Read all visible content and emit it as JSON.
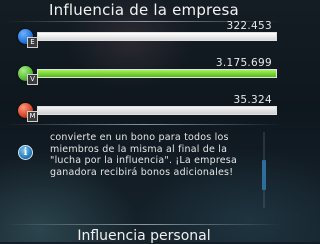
{
  "header": {
    "title": "Influencia de la empresa"
  },
  "companies": [
    {
      "letter": "E",
      "value_text": "322.453",
      "share": 1.0,
      "icon_color": "#1a6fd6",
      "bar_color": "#ffffff"
    },
    {
      "letter": "V",
      "value_text": "3.175.699",
      "share": 1.0,
      "icon_color": "#4fb32b",
      "bar_color": "#6fcf2f"
    },
    {
      "letter": "M",
      "value_text": "35.324",
      "share": 1.0,
      "icon_color": "#d23a1e",
      "bar_color": "#e6e6e6"
    }
  ],
  "info": {
    "text": "convierte en un bono para todos los miembros de la misma al final de la \"lucha por la influencia\". ¡La empresa ganadora recibirá bonos adicionales!"
  },
  "footer": {
    "title": "Influencia personal"
  }
}
